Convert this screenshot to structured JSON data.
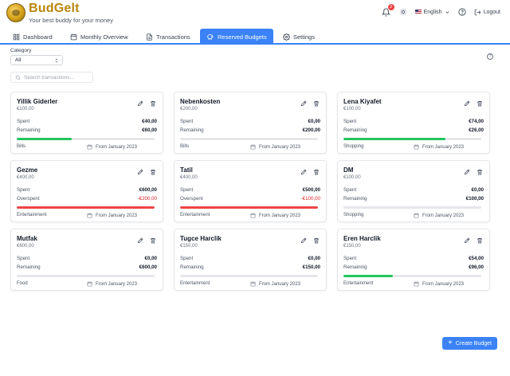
{
  "app": {
    "name": "BudGelt",
    "tagline": "Your best buddy for your money",
    "notification_count": "2",
    "language": "English",
    "logout_label": "Logout"
  },
  "nav": {
    "tabs": [
      {
        "label": "Dashboard",
        "icon": "dashboard-icon"
      },
      {
        "label": "Monthly Overview",
        "icon": "calendar-icon"
      },
      {
        "label": "Transactions",
        "icon": "document-icon"
      },
      {
        "label": "Reserved Budgets",
        "icon": "piggy-bank-icon",
        "active": true
      },
      {
        "label": "Settings",
        "icon": "gear-icon"
      }
    ]
  },
  "filters": {
    "category_label": "Category",
    "category_value": "All",
    "search_placeholder": "Search transactions..."
  },
  "budgets": [
    {
      "name": "Yillik Giderler",
      "total": "€100,00",
      "spent_label": "Spent",
      "spent": "€40,00",
      "rem_label": "Remaining",
      "remaining": "€60,00",
      "progress": 0.4,
      "status": "ok",
      "category": "Bills",
      "date": "From January 2023"
    },
    {
      "name": "Nebenkosten",
      "total": "€200,00",
      "spent_label": "Spent",
      "spent": "€0,00",
      "rem_label": "Remaining",
      "remaining": "€200,00",
      "progress": 0,
      "status": "ok",
      "category": "Bills",
      "date": "From January 2023"
    },
    {
      "name": "Lena Kiyafet",
      "total": "€100,00",
      "spent_label": "Spent",
      "spent": "€74,00",
      "rem_label": "Remaining",
      "remaining": "€26,00",
      "progress": 0.74,
      "status": "ok",
      "category": "Shopping",
      "date": "From January 2023"
    },
    {
      "name": "Gezme",
      "total": "€400,00",
      "spent_label": "Spent",
      "spent": "€600,00",
      "rem_label": "Overspent",
      "remaining": "-€200,00",
      "progress": 1,
      "status": "over",
      "category": "Entertainment",
      "date": "From January 2023"
    },
    {
      "name": "Tatil",
      "total": "€400,00",
      "spent_label": "Spent",
      "spent": "€500,00",
      "rem_label": "Overspent",
      "remaining": "-€100,00",
      "progress": 1,
      "status": "over",
      "category": "Entertainment",
      "date": "From January 2023"
    },
    {
      "name": "DM",
      "total": "€100,00",
      "spent_label": "Spent",
      "spent": "€0,00",
      "rem_label": "Remaining",
      "remaining": "€100,00",
      "progress": 0,
      "status": "ok",
      "category": "Shopping",
      "date": "From January 2023"
    },
    {
      "name": "Mutfak",
      "total": "€600,00",
      "spent_label": "Spent",
      "spent": "€0,00",
      "rem_label": "Remaining",
      "remaining": "€600,00",
      "progress": 0,
      "status": "ok",
      "category": "Food",
      "date": "From January 2023"
    },
    {
      "name": "Tugce Harclik",
      "total": "€150,00",
      "spent_label": "Spent",
      "spent": "€0,00",
      "rem_label": "Remaining",
      "remaining": "€150,00",
      "progress": 0,
      "status": "ok",
      "category": "Entertainment",
      "date": "From January 2023"
    },
    {
      "name": "Eren Harclik",
      "total": "€150,00",
      "spent_label": "Spent",
      "spent": "€54,00",
      "rem_label": "Remaining",
      "remaining": "€96,00",
      "progress": 0.36,
      "status": "ok",
      "category": "Entertainment",
      "date": "From January 2023"
    }
  ],
  "create_button": "Create Budget",
  "colors": {
    "accent": "#3b82f6",
    "ok": "#22c55e",
    "over": "#ef4444",
    "brand": "#b8860b"
  }
}
